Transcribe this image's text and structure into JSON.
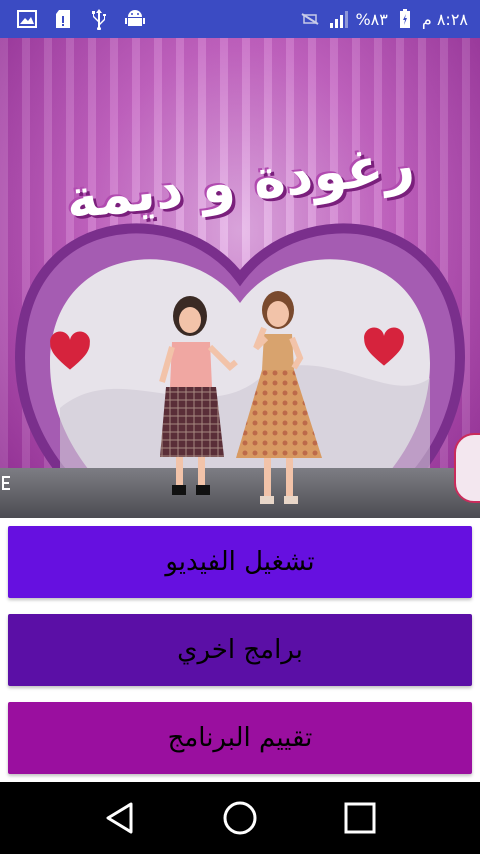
{
  "status_bar": {
    "time": "٨:٢٨ م",
    "battery": "%٨٣",
    "icons": [
      "image-icon",
      "sd-card-icon",
      "usb-icon",
      "android-icon",
      "no-sim-icon",
      "signal-icon",
      "battery-icon"
    ]
  },
  "hero": {
    "title": "رغودة و ديمة",
    "accent_color": "#c66ac4"
  },
  "menu": {
    "play_video": "تشغيل الفيديو",
    "other_apps": "برامج اخري",
    "rate_app": "تقييم البرنامج"
  },
  "colors": {
    "status_bar": "#3b4bc3",
    "button1": "#6610e0",
    "button2": "#5b0fa6",
    "button3": "#9a0f9f",
    "nav_bar": "#000000"
  },
  "nav": {
    "icons": [
      "back-icon",
      "home-icon",
      "recents-icon"
    ]
  }
}
